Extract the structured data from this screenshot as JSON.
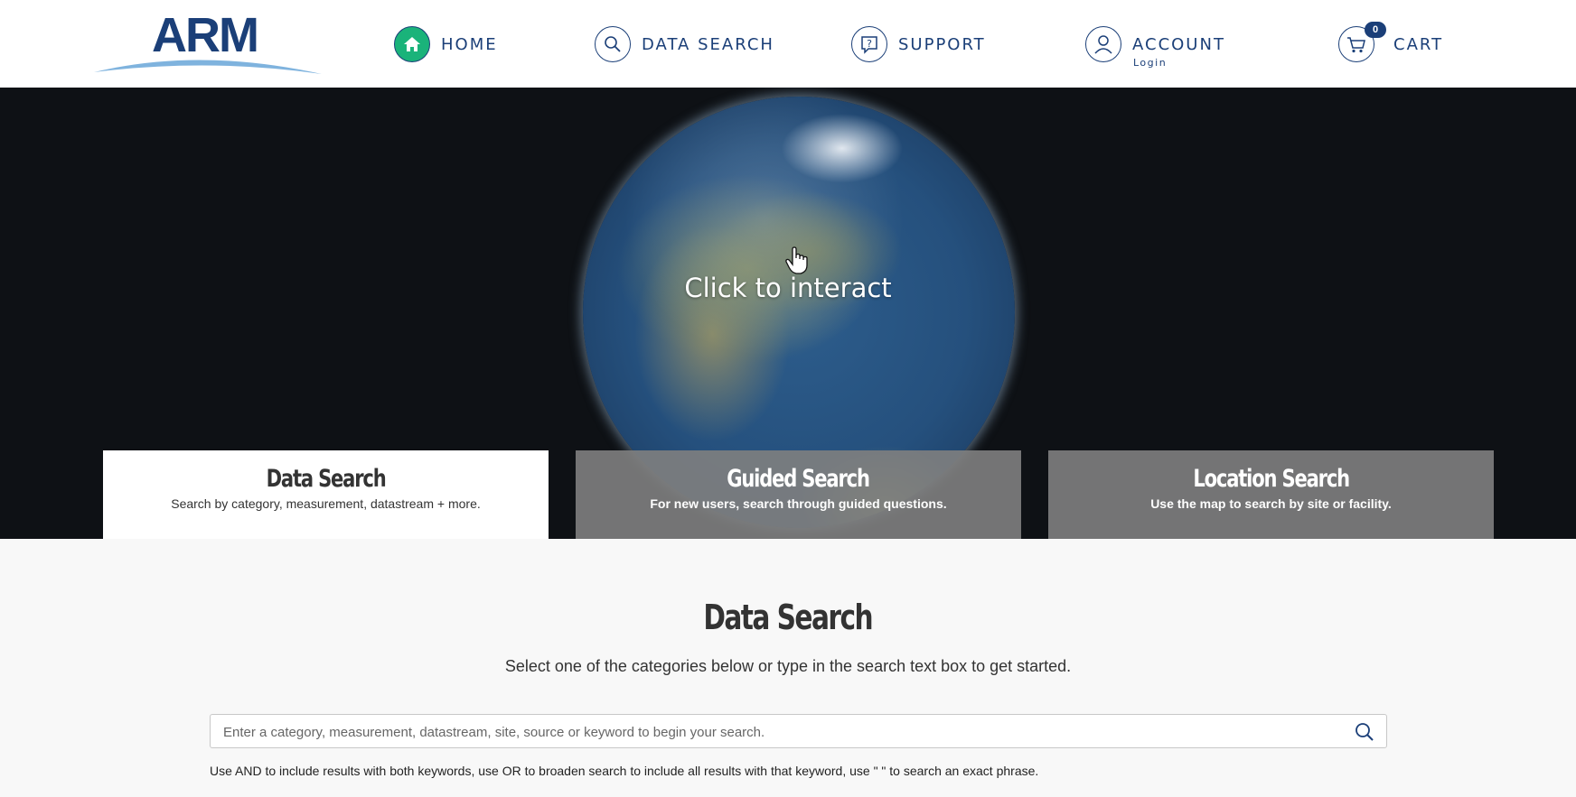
{
  "header": {
    "logo_text": "ARM",
    "nav": [
      {
        "label": "HOME",
        "icon": "home-icon"
      },
      {
        "label": "DATA SEARCH",
        "icon": "search-icon"
      },
      {
        "label": "SUPPORT",
        "icon": "help-icon"
      },
      {
        "label": "ACCOUNT",
        "sublabel": "Login",
        "icon": "user-icon"
      },
      {
        "label": "CART",
        "icon": "cart-icon",
        "badge": "0"
      }
    ]
  },
  "hero": {
    "interact_hint": "Click to interact"
  },
  "tabs": [
    {
      "title": "Data Search",
      "desc": "Search by category, measurement, datastream + more.",
      "active": true
    },
    {
      "title": "Guided Search",
      "desc": "For new users, search through guided questions.",
      "active": false
    },
    {
      "title": "Location Search",
      "desc": "Use the map to search by site or facility.",
      "active": false
    }
  ],
  "main": {
    "title": "Data Search",
    "subtitle": "Select one of the categories below or type in the search text box to get started.",
    "search": {
      "placeholder": "Enter a category, measurement, datastream, site, source or keyword to begin your search.",
      "value": ""
    },
    "help_text": "Use AND to include results with both keywords, use OR to broaden search to include all results with that keyword, use \" \" to search an exact phrase."
  },
  "colors": {
    "brand_navy": "#1b3f78",
    "home_active_green": "#1ab37a",
    "hero_background": "#0e1115",
    "tab_inactive": "#808080"
  }
}
